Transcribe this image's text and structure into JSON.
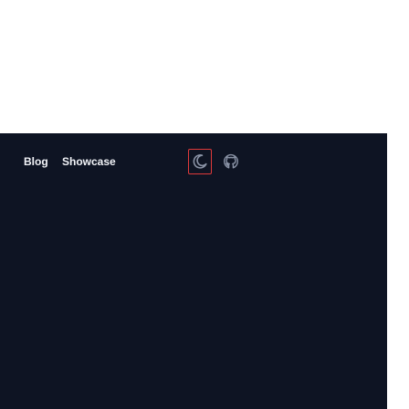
{
  "nav": {
    "links": [
      {
        "label": "Blog"
      },
      {
        "label": "Showcase"
      }
    ],
    "icons": {
      "theme_toggle": "moon-icon",
      "github": "github-icon"
    }
  },
  "colors": {
    "panel_background": "#0e1423",
    "nav_text": "#f2f4f8",
    "focus_outline": "#e03a3a",
    "icon_stroke": "#8a93a6"
  }
}
